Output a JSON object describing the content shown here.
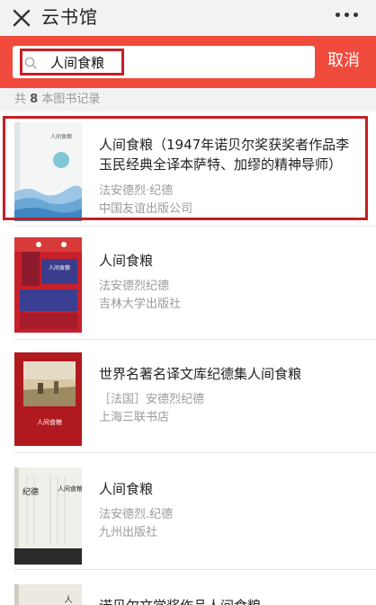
{
  "header": {
    "title": "云书馆"
  },
  "search": {
    "value": "人间食粮",
    "cancel_label": "取消"
  },
  "results": {
    "count_prefix": "共",
    "count": "8",
    "count_suffix": "本图书记录"
  },
  "books": [
    {
      "title": "人间食粮（1947年诺贝尔奖获奖者作品李玉民经典全译本萨特、加缪的精神导师）",
      "author": "法安德烈·纪德",
      "publisher": "中国友谊出版公司",
      "cover_text": "人间食粮"
    },
    {
      "title": "人间食粮",
      "author": "法安德烈纪德",
      "publisher": "吉林大学出版社",
      "cover_text": "人间食粮"
    },
    {
      "title": "世界名著名译文库纪德集人间食粮",
      "author": "［法国］安德烈纪德",
      "publisher": "上海三联书店",
      "cover_text": "人间食粮"
    },
    {
      "title": "人间食粮",
      "author": "法安德烈.纪德",
      "publisher": "九州出版社",
      "cover_text_1": "纪德",
      "cover_text_2": "人间食粮"
    },
    {
      "title": "诺贝尔文学奖作品人间食粮",
      "cover_text": "人"
    }
  ],
  "colors": {
    "accent": "#f04a3c",
    "highlight": "#c41f24"
  }
}
